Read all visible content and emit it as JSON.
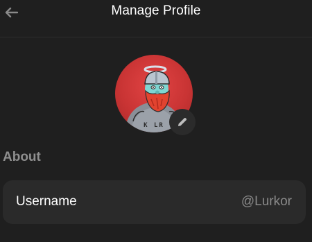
{
  "header": {
    "title": "Manage Profile",
    "back_icon": "arrow-left-icon"
  },
  "profile": {
    "avatar_description_icon": "avatar-illustration",
    "avatar_shirt_text": "K LR",
    "edit_icon": "pencil-icon"
  },
  "about": {
    "section_label": "About",
    "fields": [
      {
        "label": "Username",
        "value": "@Lurkor"
      }
    ]
  },
  "colors": {
    "background": "#1f1f1f",
    "card": "#2a2a2a",
    "avatar_bg": "#d33a3a",
    "muted_text": "#8e8e8e"
  }
}
